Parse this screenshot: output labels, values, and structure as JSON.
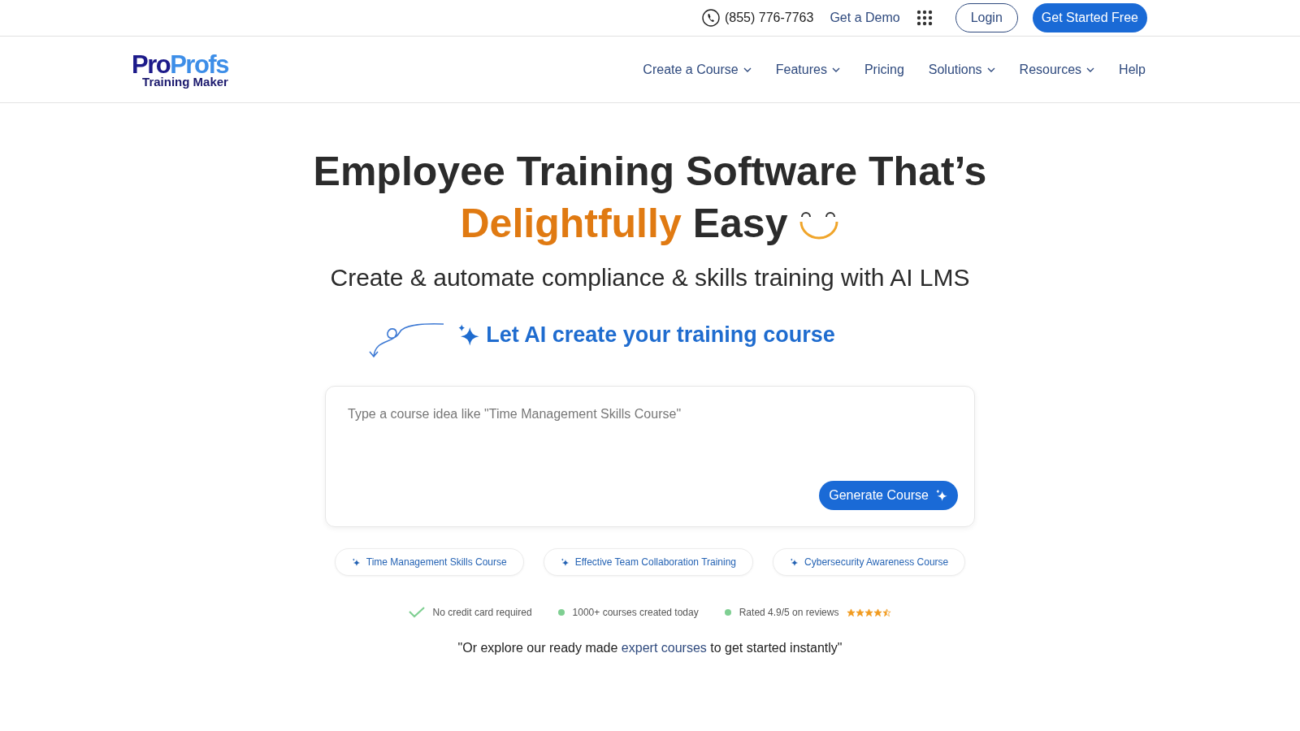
{
  "top_bar": {
    "phone": "(855) 776-7763",
    "demo_link": "Get a Demo",
    "login_button": "Login",
    "cta_button": "Get Started Free"
  },
  "logo": {
    "part_1": "Pro",
    "part_2": "Profs",
    "subtitle": "Training Maker"
  },
  "nav": [
    {
      "label": "Create a Course",
      "has_menu": true
    },
    {
      "label": "Features",
      "has_menu": true
    },
    {
      "label": "Pricing",
      "has_menu": false
    },
    {
      "label": "Solutions",
      "has_menu": true
    },
    {
      "label": "Resources",
      "has_menu": true
    },
    {
      "label": "Help",
      "has_menu": false
    }
  ],
  "hero": {
    "headline_line_1": "Employee Training Software That’s",
    "headline_highlight": "Delightfully",
    "headline_rest": "Easy",
    "subheadline": "Create & automate compliance & skills training with AI LMS",
    "ai_prompt": "Let AI create your training course"
  },
  "course_input": {
    "placeholder": "Type a course idea like \"Time Management Skills Course\"",
    "button": "Generate Course"
  },
  "suggestions": [
    "Time Management Skills Course",
    "Effective Team Collaboration Training",
    "Cybersecurity Awareness Course"
  ],
  "benefits": [
    {
      "kind": "check",
      "text": "No credit card required"
    },
    {
      "kind": "dot",
      "text": "1000+ courses created today"
    },
    {
      "kind": "dot",
      "text": "Rated 4.9/5 on reviews",
      "stars": 4.5
    }
  ],
  "explore": {
    "before": "\"Or explore our ready made ",
    "link": "expert courses",
    "after": " to get started instantly\""
  }
}
